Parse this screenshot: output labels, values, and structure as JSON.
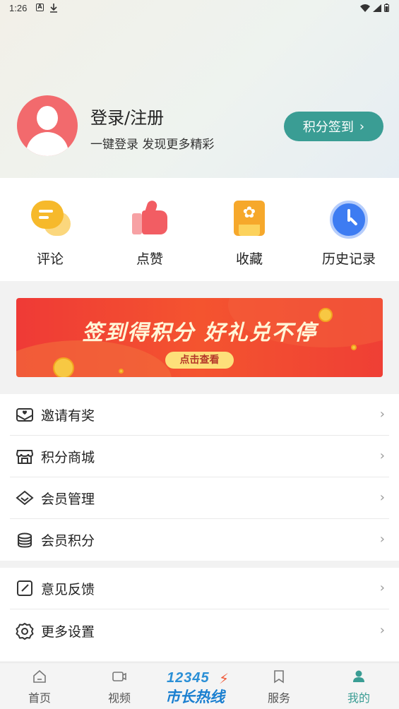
{
  "status_bar": {
    "time": "1:26"
  },
  "profile": {
    "login_title": "登录/注册",
    "login_subtitle": "一键登录 发现更多精彩",
    "checkin_button": "积分签到",
    "checkin_chevron": "›"
  },
  "quick_actions": [
    {
      "label": "评论",
      "icon": "comment-icon"
    },
    {
      "label": "点赞",
      "icon": "thumbs-up-icon"
    },
    {
      "label": "收藏",
      "icon": "favorite-icon"
    },
    {
      "label": "历史记录",
      "icon": "clock-icon"
    }
  ],
  "banner": {
    "title": "签到得积分  好礼兑不停",
    "button": "点击查看",
    "colors": {
      "background": "#ef3a36",
      "button": "#fde07a"
    }
  },
  "menu_group1": [
    {
      "label": "邀请有奖",
      "icon": "gift-envelope-icon"
    },
    {
      "label": "积分商城",
      "icon": "store-icon"
    },
    {
      "label": "会员管理",
      "icon": "diamond-icon"
    },
    {
      "label": "会员积分",
      "icon": "coins-stack-icon"
    }
  ],
  "menu_group2": [
    {
      "label": "意见反馈",
      "icon": "edit-icon"
    },
    {
      "label": "更多设置",
      "icon": "gear-icon"
    }
  ],
  "bottom_nav": {
    "tabs": [
      {
        "label": "首页",
        "icon": "home-icon"
      },
      {
        "label": "视频",
        "icon": "video-icon"
      },
      {
        "label": "服务",
        "icon": "bookmark-icon"
      },
      {
        "label": "我的",
        "icon": "user-icon",
        "active": true
      }
    ],
    "center_logo_number": "12345",
    "center_logo_text": "市长热线"
  },
  "accent_color": "#3a9d94"
}
